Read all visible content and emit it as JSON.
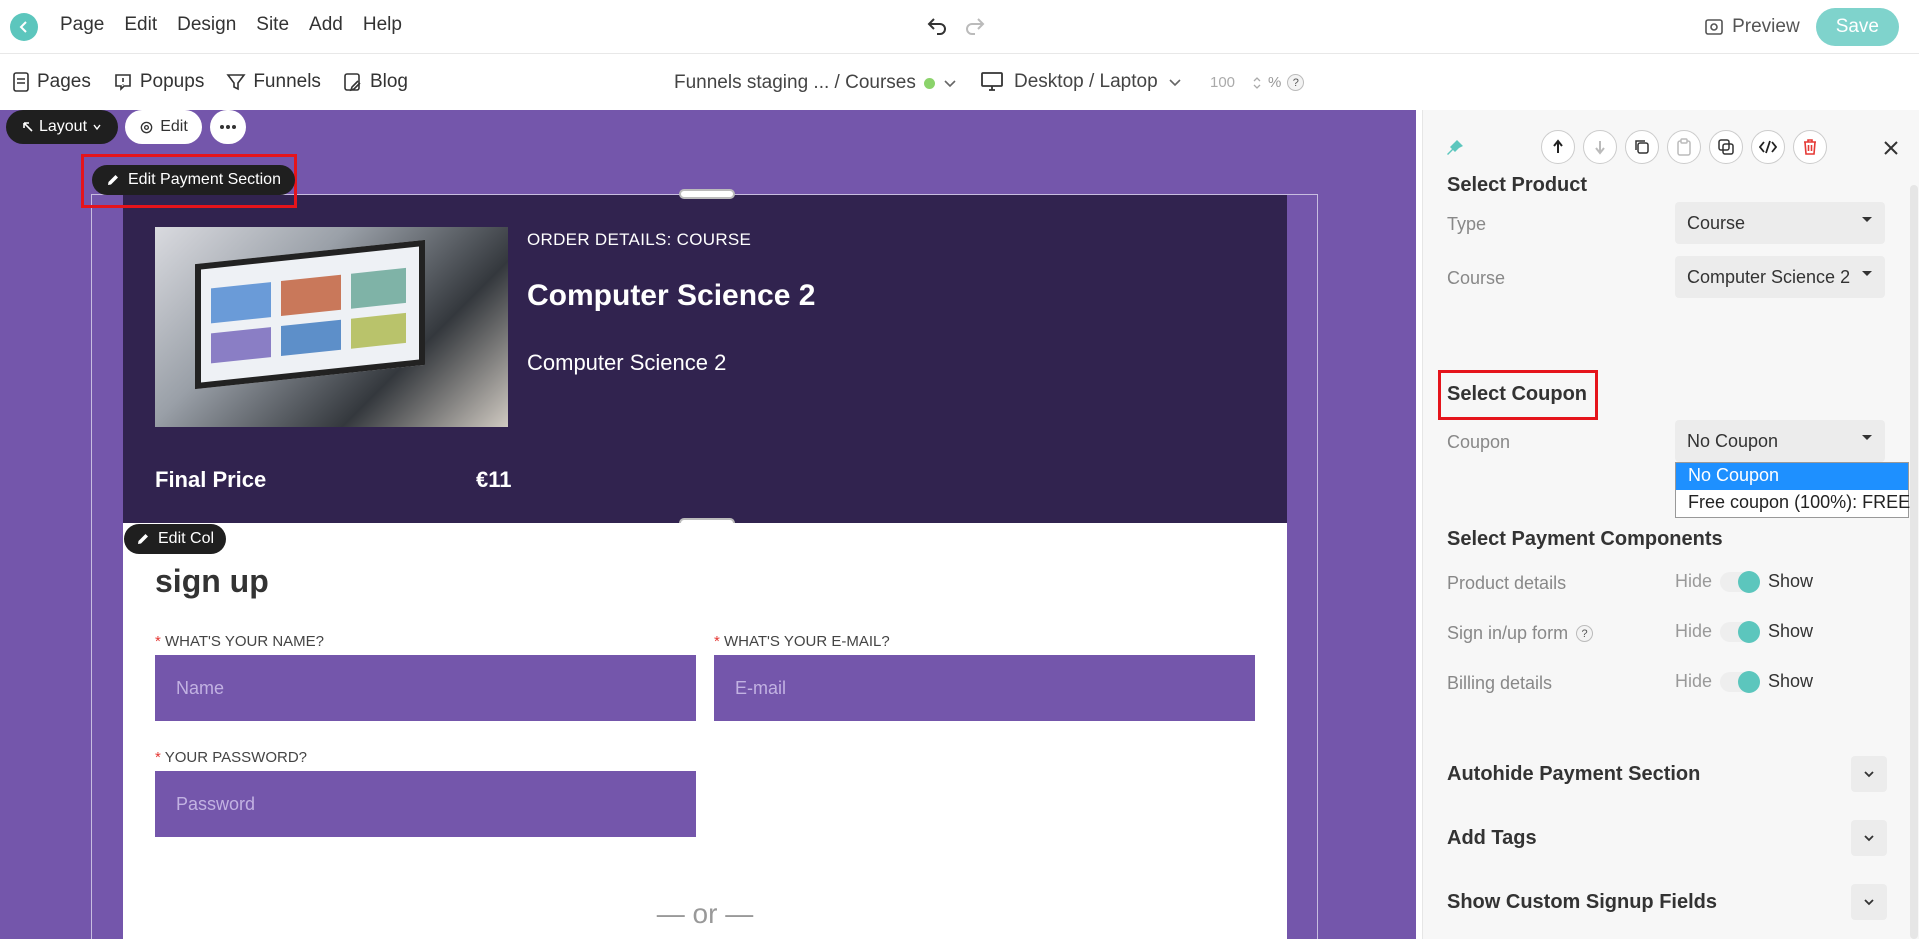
{
  "topbar": {
    "menu": [
      "Page",
      "Edit",
      "Design",
      "Site",
      "Add",
      "Help"
    ],
    "preview_label": "Preview",
    "save_label": "Save"
  },
  "secondbar": {
    "nav": [
      "Pages",
      "Popups",
      "Funnels",
      "Blog"
    ],
    "breadcrumb": "Funnels staging ... / Courses",
    "device": "Desktop / Laptop",
    "zoom_value": "100",
    "zoom_unit": "%",
    "help": "?"
  },
  "canvas": {
    "layout_label": "Layout",
    "edit_label": "Edit",
    "edit_payment_label": "Edit Payment Section",
    "order_label": "ORDER DETAILS: COURSE",
    "course_title": "Computer Science 2",
    "course_subtitle": "Computer Science 2",
    "final_price_label": "Final Price",
    "final_price_value": "€11",
    "edit_col_label": "Edit Col",
    "signup_title": "sign up",
    "name_label": "WHAT'S YOUR NAME?",
    "name_placeholder": "Name",
    "email_label": "WHAT'S YOUR E-MAIL?",
    "email_placeholder": "E-mail",
    "password_label": "YOUR PASSWORD?",
    "password_placeholder": "Password",
    "required_mark": "*",
    "or_divider": "— or —"
  },
  "panel": {
    "select_product": "Select Product",
    "type_label": "Type",
    "type_value": "Course",
    "course_label": "Course",
    "course_value": "Computer Science 2",
    "select_coupon": "Select Coupon",
    "coupon_label": "Coupon",
    "coupon_value": "No Coupon",
    "coupon_options": [
      "No Coupon",
      "Free coupon (100%): FREE"
    ],
    "select_components": "Select Payment Components",
    "components": [
      {
        "label": "Product details",
        "hide": "Hide",
        "show": "Show"
      },
      {
        "label": "Sign in/up form",
        "hide": "Hide",
        "show": "Show"
      },
      {
        "label": "Billing details",
        "hide": "Hide",
        "show": "Show"
      }
    ],
    "help": "?",
    "accordions": [
      "Autohide Payment Section",
      "Add Tags",
      "Show Custom Signup Fields"
    ]
  },
  "colors": {
    "accent": "#5cc6bd",
    "canvas_purple": "#7456ab",
    "order_bg": "#31234f",
    "highlight_red": "#e5141b",
    "dropdown_selected": "#1e90ff"
  }
}
